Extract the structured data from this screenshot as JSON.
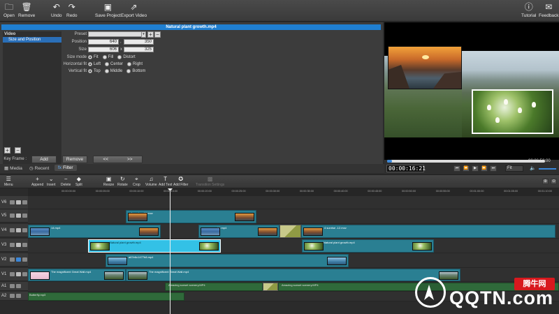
{
  "toolbar": {
    "open": "Open",
    "remove": "Remove",
    "undo": "Undo",
    "redo": "Redo",
    "save_project": "Save Project",
    "export_video": "Export Video",
    "tutorial": "Tutorial",
    "feedback": "Feedback"
  },
  "inspector": {
    "title": "Natural plant growth.mp4",
    "category_header": "Video",
    "category_item": "Size and Position",
    "preset_label": "Preset",
    "position_label": "Position",
    "position_x": "640",
    "position_y": "350",
    "size_label": "Size",
    "size_w": "606",
    "size_h": "325",
    "pos_sep": ",",
    "size_sep": "x",
    "size_mode_label": "Size mode",
    "size_mode_options": [
      "Fit",
      "Fill",
      "Distort"
    ],
    "hfit_label": "Horizontal fit",
    "hfit_options": [
      "Left",
      "Center",
      "Right"
    ],
    "vfit_label": "Vertical fit",
    "vfit_options": [
      "Top",
      "Middle",
      "Bottom"
    ],
    "keyframe_label": "Key Frame :",
    "add_label": "Add",
    "remove_label": "Remove",
    "prev_label": "<<",
    "next_label": ">>"
  },
  "tabs": {
    "media": "Media",
    "recent": "Recent",
    "filter": "Filter"
  },
  "preview": {
    "timecode": "00:00:16:21",
    "duration": "00:06:52:00",
    "fit": "Fit"
  },
  "timeline_toolbar": {
    "menu": "Menu",
    "append": "Append",
    "insert": "Insert",
    "delete": "Delete",
    "split": "Split",
    "resize": "Resize",
    "rotate": "Rotate",
    "crop": "Crop",
    "volume": "Volume",
    "add_text": "Add Text",
    "add_filter": "Add Filter",
    "transition_settings": "Transition Settings"
  },
  "ruler_labels": [
    "00:00:00:00",
    "00:00:05:00",
    "00:00:10:00",
    "00:00:15:00",
    "00:00:20:00",
    "00:00:25:00",
    "00:00:30:00",
    "00:00:35:00",
    "00:00:40:00",
    "00:00:45:00",
    "00:00:50:00",
    "00:00:55:00",
    "00:01:00:00",
    "00:01:05:00",
    "00:01:10:00",
    "00:01:15:00"
  ],
  "tracks": [
    "V6",
    "V5",
    "V4",
    "V3",
    "V2",
    "V1",
    "A1",
    "A2"
  ],
  "clips": {
    "v5": "4 sunrise -12.mov",
    "v4a": "14.mp4",
    "v4b": "14.mp4",
    "v4c": "4 sunrise -12.mov",
    "v3a": "Natural plant growth.mp4",
    "v3b": "Natural plant growth.mp4",
    "v2": "a67e6c1477b8.mp4",
    "v1a": "The magnificent Great Wall.mp4",
    "v1b": "The magnificent Great Wall.mp4",
    "a1a": "Amazing sunset scenery.MP4",
    "a1b": "Amazing sunset scenery.MP4",
    "a2": "Butterfly.mp3"
  },
  "watermark": {
    "text": "QQTN.com",
    "badge": "腾牛网"
  },
  "colors": {
    "accent": "#1f7fd1",
    "selected_clip": "#33c1e6",
    "clip": "#2a7f92",
    "audio_clip": "#2f6a3a"
  }
}
